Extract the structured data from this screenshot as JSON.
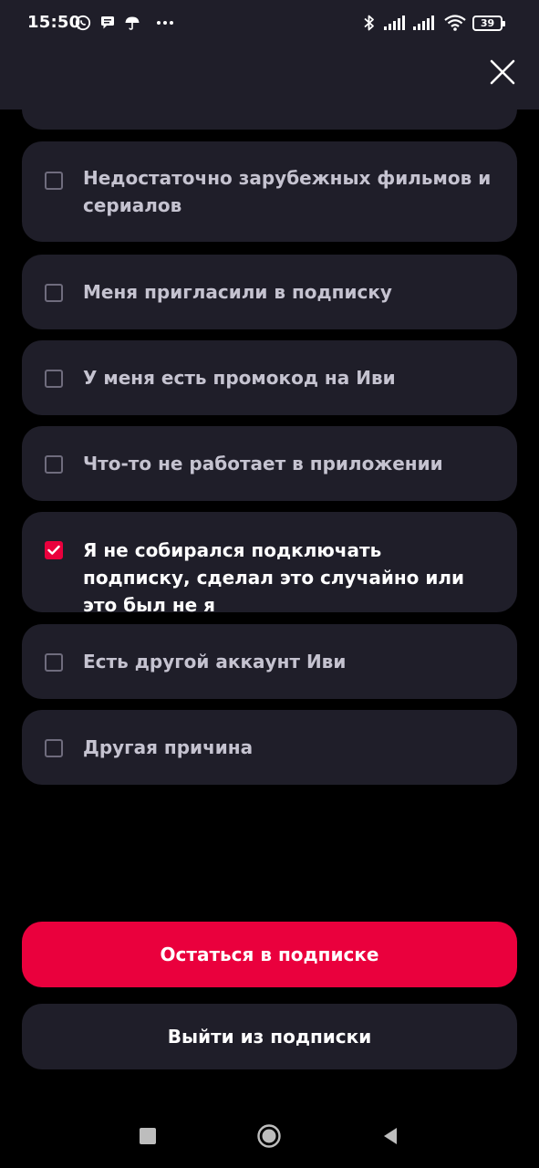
{
  "status_bar": {
    "time": "15:50",
    "battery": "39",
    "icons": [
      "whatsapp-icon",
      "message-icon",
      "umbrella-icon",
      "more-dots-icon",
      "bluetooth-icon",
      "signal-icon",
      "signal-icon",
      "wifi-icon",
      "battery-icon"
    ]
  },
  "header": {
    "close_icon": "close-icon"
  },
  "reasons": [
    {
      "label": "",
      "checked": false
    },
    {
      "label": "Недостаточно зарубежных фильмов и сериалов",
      "checked": false
    },
    {
      "label": "Меня пригласили в подписку",
      "checked": false
    },
    {
      "label": "У меня есть промокод на Иви",
      "checked": false
    },
    {
      "label": "Что-то не работает в приложении",
      "checked": false
    },
    {
      "label": "Я не собирался подключать подписку, сделал это случайно или это был не я",
      "checked": true
    },
    {
      "label": "Есть другой аккаунт Иви",
      "checked": false
    },
    {
      "label": "Другая причина",
      "checked": false
    }
  ],
  "actions": {
    "stay_label": "Остаться в подписке",
    "leave_label": "Выйти из подписки"
  },
  "colors": {
    "accent": "#ea003d",
    "card": "#1f1e29",
    "background": "#000000"
  },
  "nav_bar": {
    "icons": [
      "recents-square-icon",
      "home-circle-icon",
      "back-triangle-icon"
    ]
  }
}
